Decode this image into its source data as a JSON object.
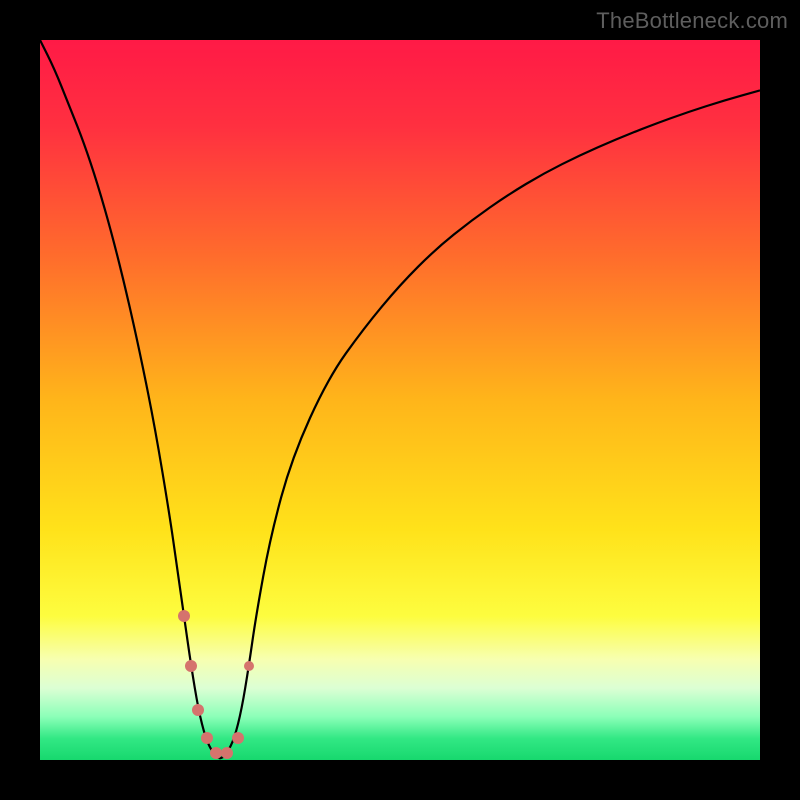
{
  "watermark": "TheBottleneck.com",
  "chart_data": {
    "type": "line",
    "title": "",
    "xlabel": "",
    "ylabel": "",
    "xlim": [
      0,
      100
    ],
    "ylim": [
      0,
      100
    ],
    "grid": false,
    "legend": false,
    "background_gradient": {
      "orientation": "vertical",
      "stops": [
        {
          "pos": 0.0,
          "color": "#ff1a46"
        },
        {
          "pos": 0.12,
          "color": "#ff3040"
        },
        {
          "pos": 0.3,
          "color": "#ff6c2c"
        },
        {
          "pos": 0.5,
          "color": "#ffb51a"
        },
        {
          "pos": 0.68,
          "color": "#ffe21a"
        },
        {
          "pos": 0.8,
          "color": "#fdfd3f"
        },
        {
          "pos": 0.86,
          "color": "#f7ffb0"
        },
        {
          "pos": 0.9,
          "color": "#dcffd4"
        },
        {
          "pos": 0.94,
          "color": "#8bffb8"
        },
        {
          "pos": 0.97,
          "color": "#32e884"
        },
        {
          "pos": 1.0,
          "color": "#17d86e"
        }
      ]
    },
    "series": [
      {
        "name": "bottleneck-curve",
        "color": "#000000",
        "stroke_width": 2.2,
        "x": [
          0,
          2,
          4,
          6,
          8,
          10,
          12,
          14,
          16,
          18,
          19,
          20,
          21,
          22,
          23,
          24,
          25,
          26,
          27,
          28,
          29,
          30,
          32,
          35,
          40,
          45,
          50,
          55,
          60,
          65,
          70,
          75,
          80,
          85,
          90,
          95,
          100
        ],
        "y": [
          100,
          96,
          91,
          86,
          80,
          73,
          65,
          56,
          46,
          34,
          27,
          20,
          13,
          7,
          3,
          1,
          0,
          1,
          3,
          7,
          13,
          20,
          31,
          42,
          53,
          60,
          66,
          71,
          75,
          78.5,
          81.5,
          84,
          86.2,
          88.2,
          90,
          91.6,
          93
        ]
      }
    ],
    "markers": [
      {
        "x": 20.0,
        "y": 20,
        "r": 6,
        "color": "#d5736d"
      },
      {
        "x": 21.0,
        "y": 13,
        "r": 6,
        "color": "#d5736d"
      },
      {
        "x": 22.0,
        "y": 7,
        "r": 6,
        "color": "#d5736d"
      },
      {
        "x": 23.2,
        "y": 3,
        "r": 6,
        "color": "#d5736d"
      },
      {
        "x": 24.5,
        "y": 1,
        "r": 6,
        "color": "#d5736d"
      },
      {
        "x": 26.0,
        "y": 1,
        "r": 6,
        "color": "#d5736d"
      },
      {
        "x": 27.5,
        "y": 3,
        "r": 6,
        "color": "#d5736d"
      },
      {
        "x": 29.0,
        "y": 13,
        "r": 5,
        "color": "#d5736d"
      }
    ],
    "annotations": []
  }
}
